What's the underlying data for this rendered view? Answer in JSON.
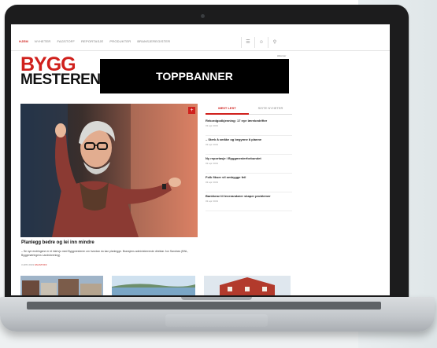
{
  "site": {
    "nav": [
      "Hjem",
      "Nyheter",
      "Fagstoff",
      "Reportasje",
      "Produkter",
      "Bransjeregister"
    ],
    "abonner": "Abonner",
    "logo": {
      "line1": "BYGG",
      "line2": "MESTEREN"
    },
    "banner": "TOPPBANNER"
  },
  "hero": {
    "title": "Planlegg bedre og lei inn mindre",
    "text": "– Se nye endringene er et intervju med Byggmesteren om hvordan du kan planlegge. Bransjens administrerende direktør Jon Sandnes (BNL, Byggenæringens Landsforening).",
    "meta_date": "3 APR 2019",
    "meta_tag": "FAGSTOFF",
    "badge": "+"
  },
  "side": {
    "tabs": [
      "Mest lest",
      "Siste nyheter"
    ],
    "items": [
      {
        "title": "Rekordgodkjenning: 17 nye lærebedrifter",
        "date": "03 apr 2019"
      },
      {
        "title": "– Sterk å småke og begynne å planne",
        "date": "03 apr 2019"
      },
      {
        "title": "Ny reportasje i Byggmesterforbundet",
        "date": "03 apr 2019"
      },
      {
        "title": "Folk fikser vil ombygge feil",
        "date": "03 apr 2019"
      },
      {
        "title": "Bankkrav til leverandører skaper problemer",
        "date": "03 apr 2019"
      }
    ]
  },
  "icons": [
    "menu-icon",
    "user-icon",
    "search-icon"
  ],
  "colors": {
    "brand_red": "#d0201c",
    "banner_bg": "#000000",
    "laptop_bezel": "#1c1c1d"
  }
}
